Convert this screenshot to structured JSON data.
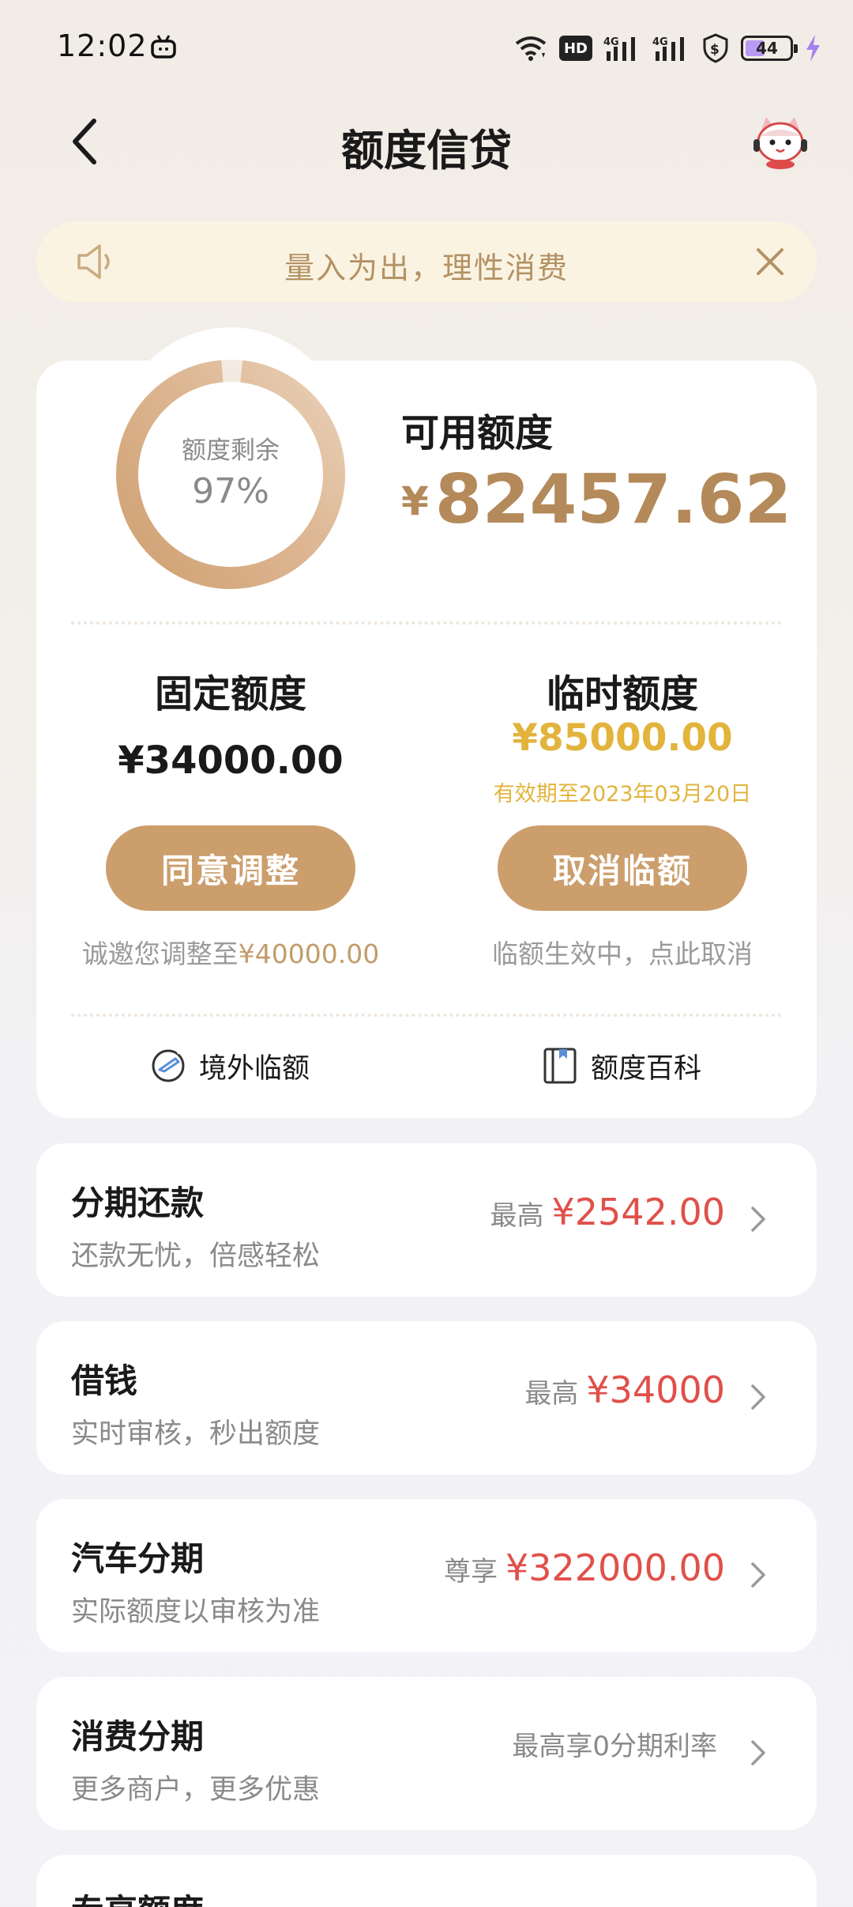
{
  "status_bar": {
    "time": "12:02",
    "hd_label": "HD",
    "battery": "44",
    "icons": [
      "tv-icon",
      "wifi-icon",
      "hd-icon",
      "signal-4g-icon",
      "signal-4g-icon",
      "shield-icon",
      "battery-icon",
      "charging-bolt-icon"
    ]
  },
  "header": {
    "title": "额度信贷",
    "back_icon": "chevron-left-icon",
    "mascot_icon": "mascot-icon"
  },
  "notice": {
    "text": "量入为出，理性消费",
    "speaker_icon": "speaker-icon",
    "close_icon": "close-icon"
  },
  "credit": {
    "ring_label": "额度剩余",
    "ring_percent_text": "97%",
    "ring_fraction": 0.97,
    "available_label": "可用额度",
    "currency_symbol": "¥",
    "available_amount": "82457.62",
    "fixed": {
      "title": "固定额度",
      "amount": "¥34000.00",
      "button": "同意调整",
      "note_prefix": "诚邀您调整至",
      "note_amount": "¥40000.00"
    },
    "temporary": {
      "title": "临时额度",
      "amount": "¥85000.00",
      "valid": "有效期至2023年03月20日",
      "button": "取消临额",
      "note": "临额生效中，点此取消"
    },
    "links": {
      "overseas": "境外临额",
      "wiki": "额度百科"
    }
  },
  "list": [
    {
      "title": "分期还款",
      "subtitle": "还款无忧，倍感轻松",
      "prefix": "最高",
      "amount": "¥2542.00"
    },
    {
      "title": "借钱",
      "subtitle": "实时审核，秒出额度",
      "prefix": "最高",
      "amount": "¥34000"
    },
    {
      "title": "汽车分期",
      "subtitle": "实际额度以审核为准",
      "prefix": "尊享",
      "amount": "¥322000.00"
    },
    {
      "title": "消费分期",
      "subtitle": "更多商户，更多优惠",
      "prefix": "最高享0分期利率",
      "amount": ""
    },
    {
      "title": "专享额度",
      "subtitle": "",
      "prefix": "",
      "amount": ""
    }
  ],
  "colors": {
    "accent_gold": "#cb9e6c",
    "amount_brown": "#b48a5b",
    "temp_yellow": "#e2b43c",
    "amount_red": "#e0504a"
  }
}
